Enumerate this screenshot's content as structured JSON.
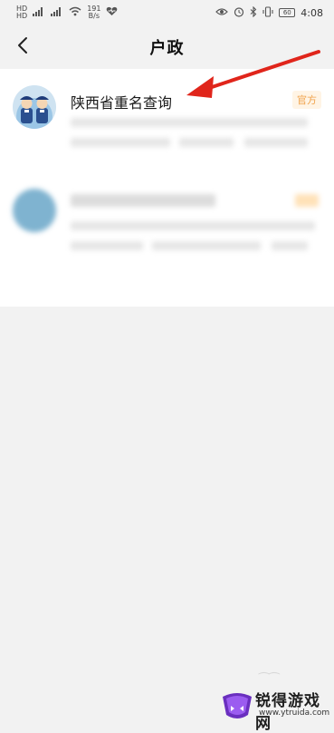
{
  "status_bar": {
    "left_label_1": "HD",
    "left_label_2": "HD",
    "net_speed": "191",
    "net_unit": "B/s",
    "battery": "60",
    "time": "4:08"
  },
  "header": {
    "title": "户政"
  },
  "results": [
    {
      "title": "陕西省重名查询",
      "tag": "官方"
    },
    {
      "title": "",
      "tag": ""
    }
  ],
  "watermark": {
    "brand": "锐得游戏网",
    "url": "www.ytruida.com"
  },
  "colors": {
    "accent_tag": "#f0a24a",
    "arrow": "#e0251b"
  }
}
